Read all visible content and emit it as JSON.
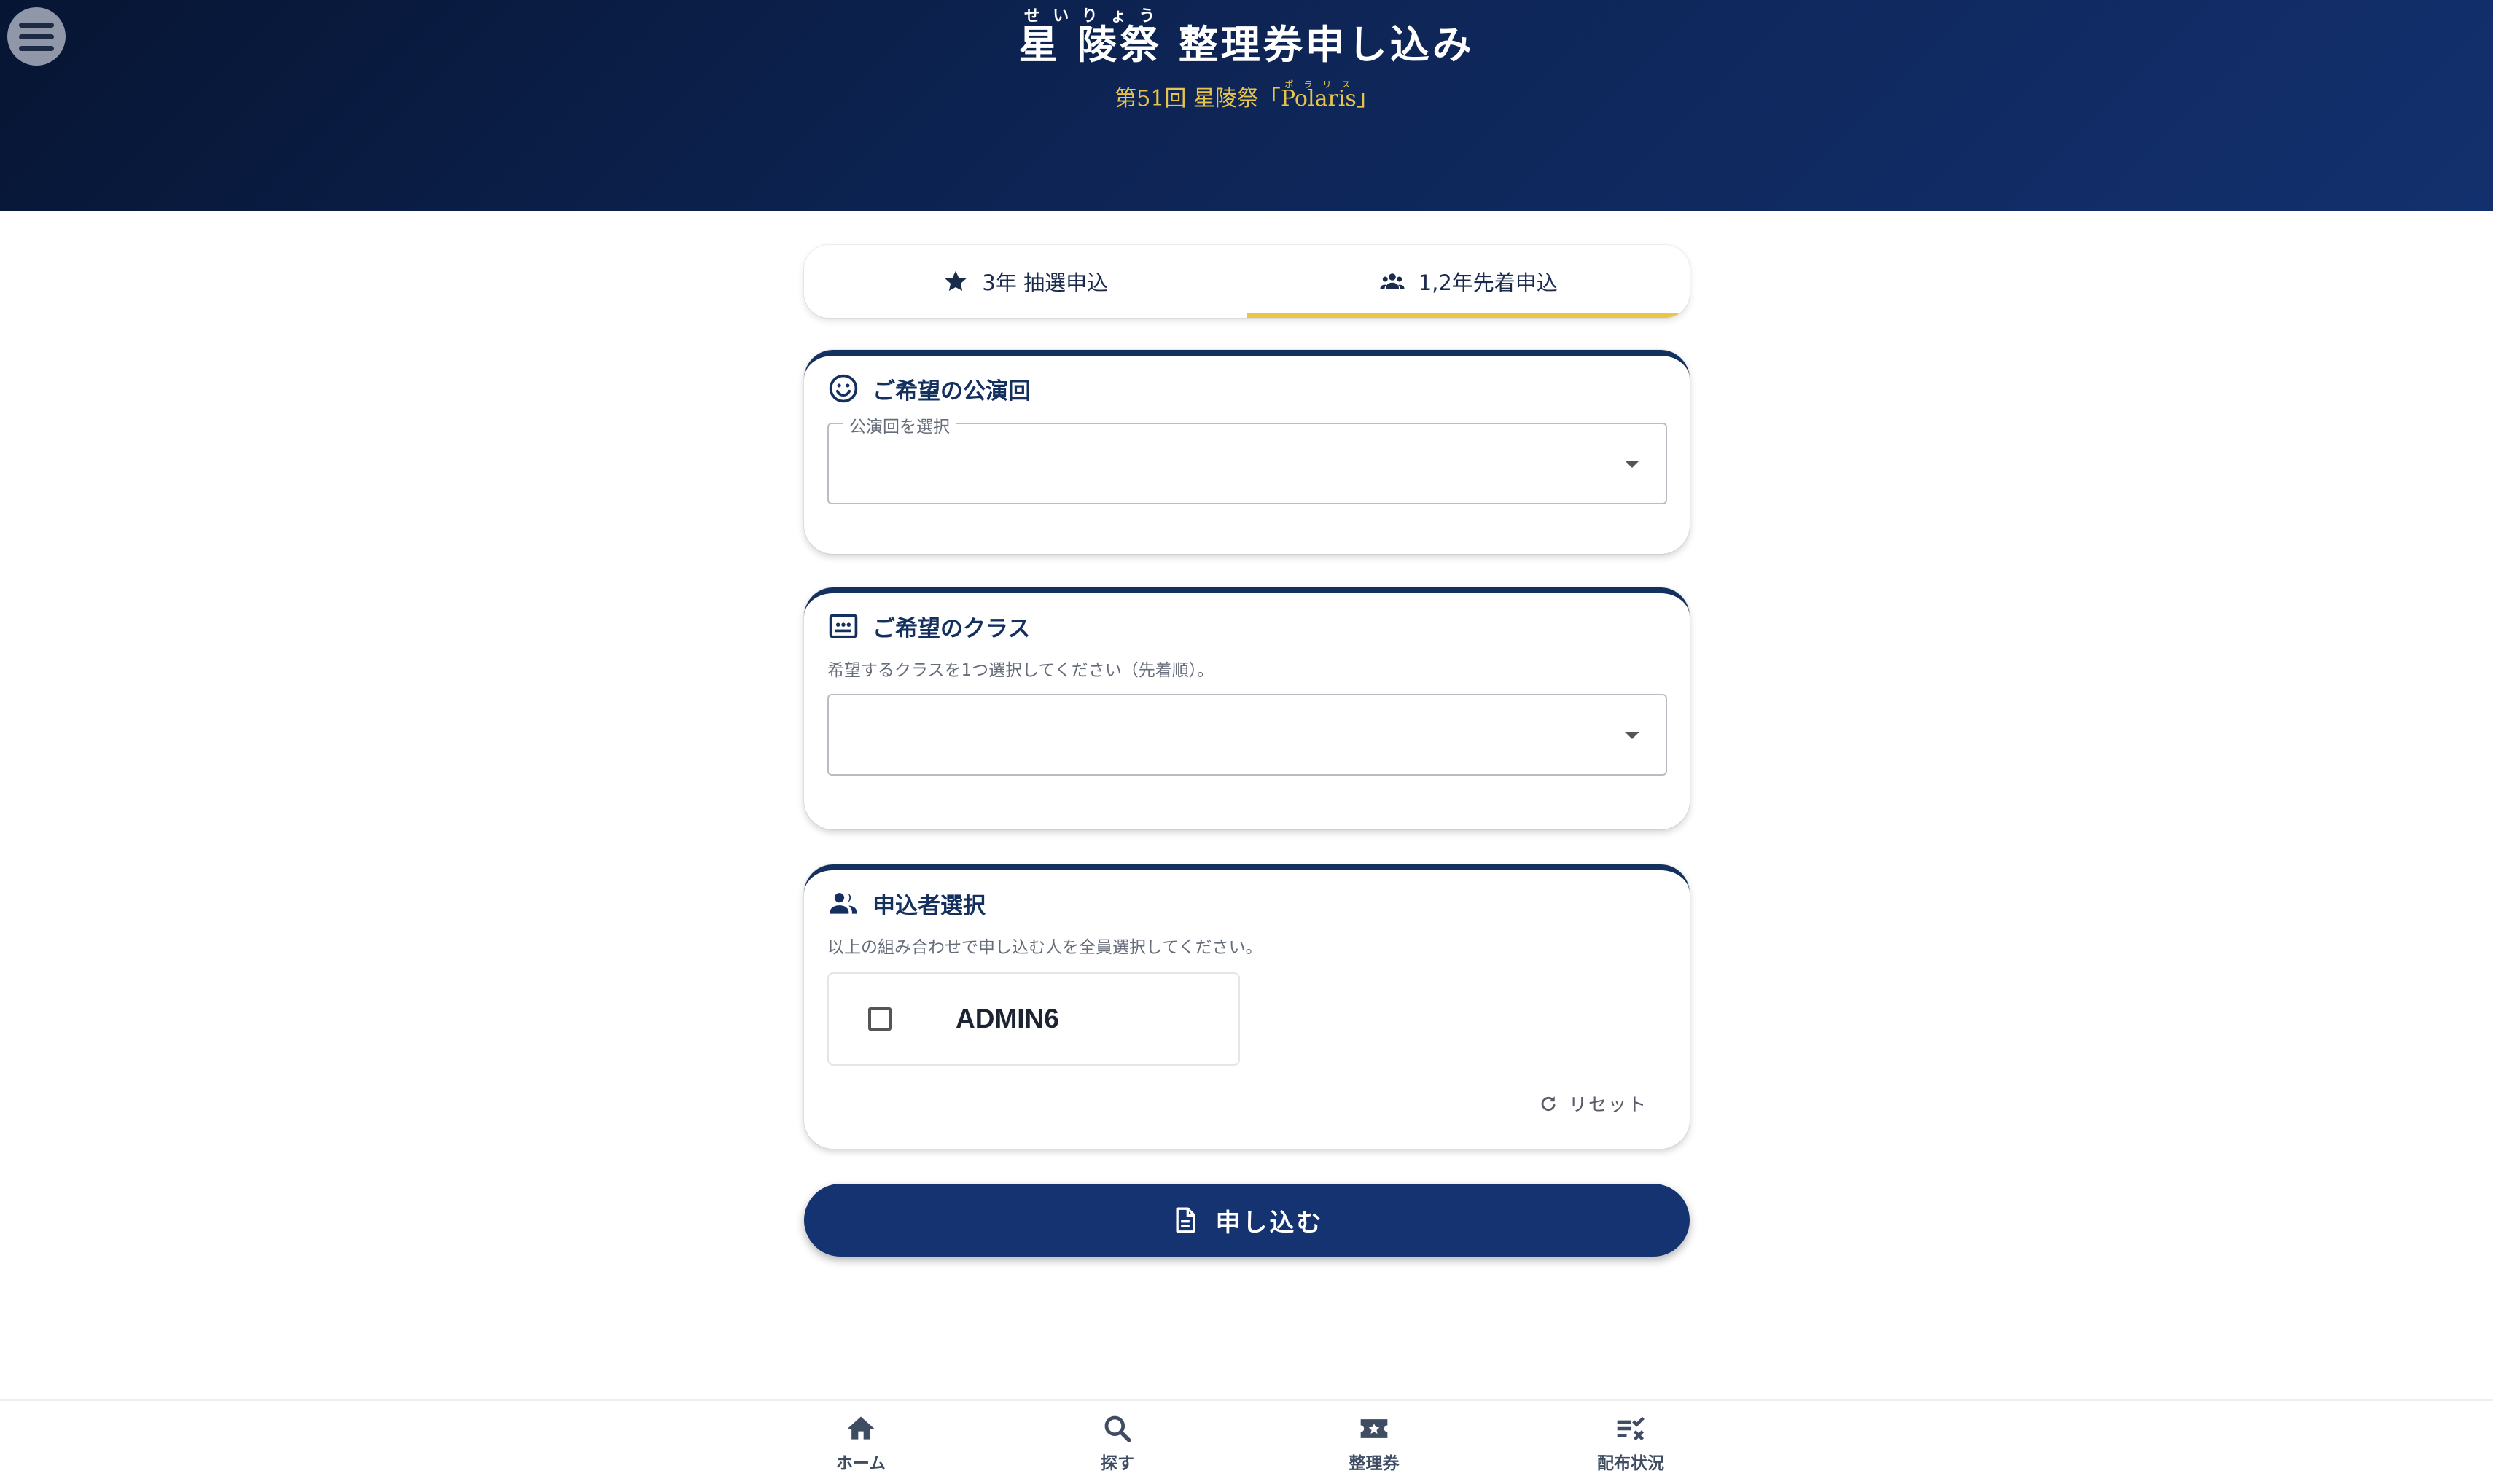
{
  "header": {
    "menu_icon": "hamburger-menu-icon",
    "title_part1": "星 陵祭",
    "title_part1_ruby": "せいりょう",
    "title_part2": " 整理券申し込み",
    "subtitle_prefix": "第51回 星陵祭「",
    "subtitle_name": "Polaris",
    "subtitle_name_ruby": "ポラリス",
    "subtitle_suffix": "」",
    "accent_color": "#e9c54a"
  },
  "tabs": [
    {
      "label": "3年 抽選申込",
      "icon": "star-icon",
      "active": false
    },
    {
      "label": "1,2年先着申込",
      "icon": "group-icon",
      "active": true
    }
  ],
  "performance_card": {
    "icon": "smiley-icon",
    "title": "ご希望の公演回",
    "select_label": "公演回を選択",
    "select_value": ""
  },
  "class_card": {
    "icon": "class-board-icon",
    "title": "ご希望のクラス",
    "helper": "希望するクラスを1つ選択してください（先着順）。",
    "select_value": ""
  },
  "applicant_card": {
    "icon": "people-icon",
    "title": "申込者選択",
    "helper": "以上の組み合わせで申し込む人を全員選択してください。",
    "applicants": [
      {
        "name": "ADMIN6",
        "checked": false
      }
    ],
    "reset_label": "リセット"
  },
  "submit": {
    "label": "申し込む",
    "icon": "document-icon",
    "color": "#153370"
  },
  "bottom_nav": [
    {
      "label": "ホーム",
      "icon": "home-icon"
    },
    {
      "label": "探す",
      "icon": "search-icon"
    },
    {
      "label": "整理券",
      "icon": "ticket-icon"
    },
    {
      "label": "配布状況",
      "icon": "checklist-icon"
    }
  ]
}
